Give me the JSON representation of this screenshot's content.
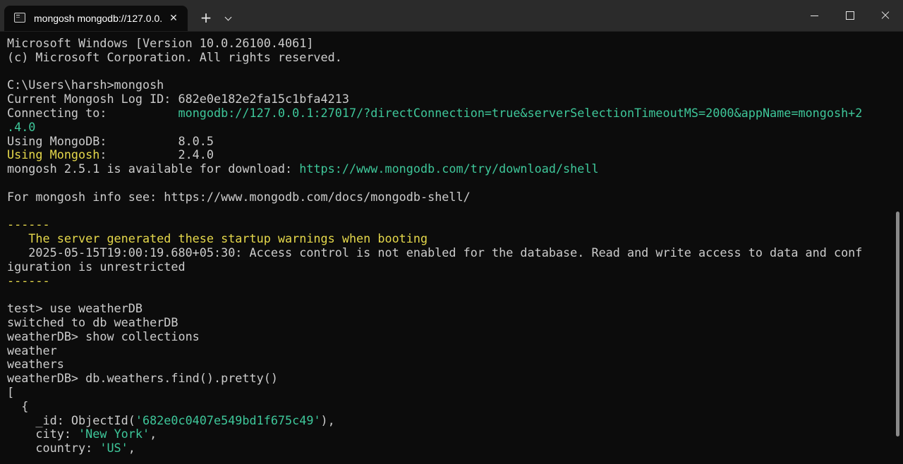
{
  "window": {
    "tab_title": "mongosh mongodb://127.0.0.",
    "tab_close": "✕",
    "new_tab": "+",
    "scroll_position": 0.92,
    "scroll_visible_fraction": 0.55
  },
  "colors": {
    "background": "#0c0c0c",
    "default_text": "#cccccc",
    "link_green": "#3ec79a",
    "string_green": "#3ec79a",
    "warning_yellow": "#e5d84b"
  },
  "terminal": {
    "lines": [
      [
        {
          "text": "Microsoft Windows [Version 10.0.26100.4061]"
        }
      ],
      [
        {
          "text": "(c) Microsoft Corporation. All rights reserved."
        }
      ],
      [
        {
          "text": ""
        }
      ],
      [
        {
          "text": "C:\\Users\\harsh>mongosh"
        }
      ],
      [
        {
          "text": "Current Mongosh Log ID: 682e0e182e2fa15c1bfa4213"
        }
      ],
      [
        {
          "text": "Connecting to:          "
        },
        {
          "text": "mongodb://127.0.0.1:27017/?directConnection=true&serverSelectionTimeoutMS=2000&appName=mongosh+2",
          "color": "cyan"
        }
      ],
      [
        {
          "text": ".4.0",
          "color": "cyan"
        }
      ],
      [
        {
          "text": "Using MongoDB:          8.0.5"
        }
      ],
      [
        {
          "text": "Using Mongosh",
          "color": "yellow"
        },
        {
          "text": ":          2.4.0"
        }
      ],
      [
        {
          "text": "mongosh 2.5.1 is available for download: "
        },
        {
          "text": "https://www.mongodb.com/try/download/shell",
          "color": "cyan"
        }
      ],
      [
        {
          "text": ""
        }
      ],
      [
        {
          "text": "For mongosh info see: https://www.mongodb.com/docs/mongodb-shell/"
        }
      ],
      [
        {
          "text": ""
        }
      ],
      [
        {
          "text": "------",
          "color": "yellow"
        }
      ],
      [
        {
          "text": "   The server generated these startup warnings when booting",
          "color": "yellow"
        }
      ],
      [
        {
          "text": "   2025-05-15T19:00:19.680+05:30: Access control is not enabled for the database. Read and write access to data and conf"
        }
      ],
      [
        {
          "text": "iguration is unrestricted"
        }
      ],
      [
        {
          "text": "------",
          "color": "yellow"
        }
      ],
      [
        {
          "text": ""
        }
      ],
      [
        {
          "text": "test> use weatherDB"
        }
      ],
      [
        {
          "text": "switched to db weatherDB"
        }
      ],
      [
        {
          "text": "weatherDB> show collections"
        }
      ],
      [
        {
          "text": "weather"
        }
      ],
      [
        {
          "text": "weathers"
        }
      ],
      [
        {
          "text": "weatherDB> db.weathers.find().pretty()"
        }
      ],
      [
        {
          "text": "["
        }
      ],
      [
        {
          "text": "  {"
        }
      ],
      [
        {
          "text": "    _id: ObjectId("
        },
        {
          "text": "'682e0c0407e549bd1f675c49'",
          "color": "cyan"
        },
        {
          "text": "),"
        }
      ],
      [
        {
          "text": "    city: "
        },
        {
          "text": "'New York'",
          "color": "cyan"
        },
        {
          "text": ","
        }
      ],
      [
        {
          "text": "    country: "
        },
        {
          "text": "'US'",
          "color": "cyan"
        },
        {
          "text": ","
        }
      ]
    ]
  }
}
